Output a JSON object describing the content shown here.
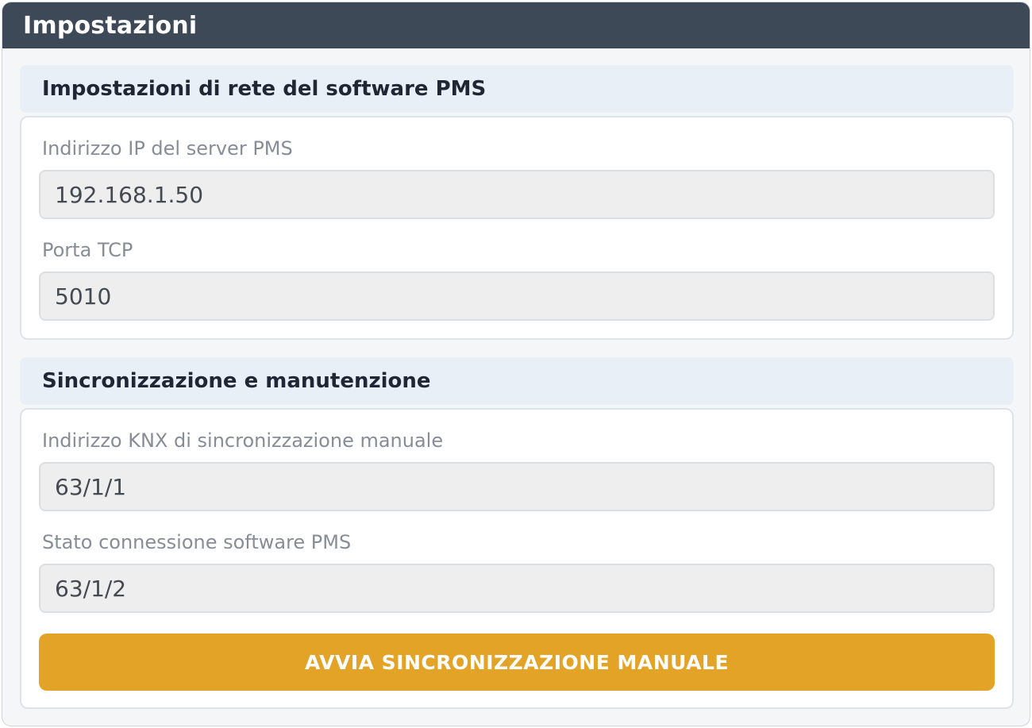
{
  "window": {
    "title": "Impostazioni"
  },
  "network_section": {
    "title": "Impostazioni di rete del software PMS",
    "fields": [
      {
        "label": "Indirizzo IP del server PMS",
        "value": "192.168.1.50"
      },
      {
        "label": "Porta TCP",
        "value": "5010"
      }
    ]
  },
  "sync_section": {
    "title": "Sincronizzazione e manutenzione",
    "fields": [
      {
        "label": "Indirizzo KNX di sincronizzazione manuale",
        "value": "63/1/1"
      },
      {
        "label": "Stato connessione software PMS",
        "value": "63/1/2"
      }
    ],
    "button_label": "AVVIA SINCRONIZZAZIONE MANUALE"
  },
  "colors": {
    "titlebar": "#3d4957",
    "section_header": "#e9eff6",
    "input_background": "#eeeeee",
    "accent_button": "#e3a327"
  }
}
